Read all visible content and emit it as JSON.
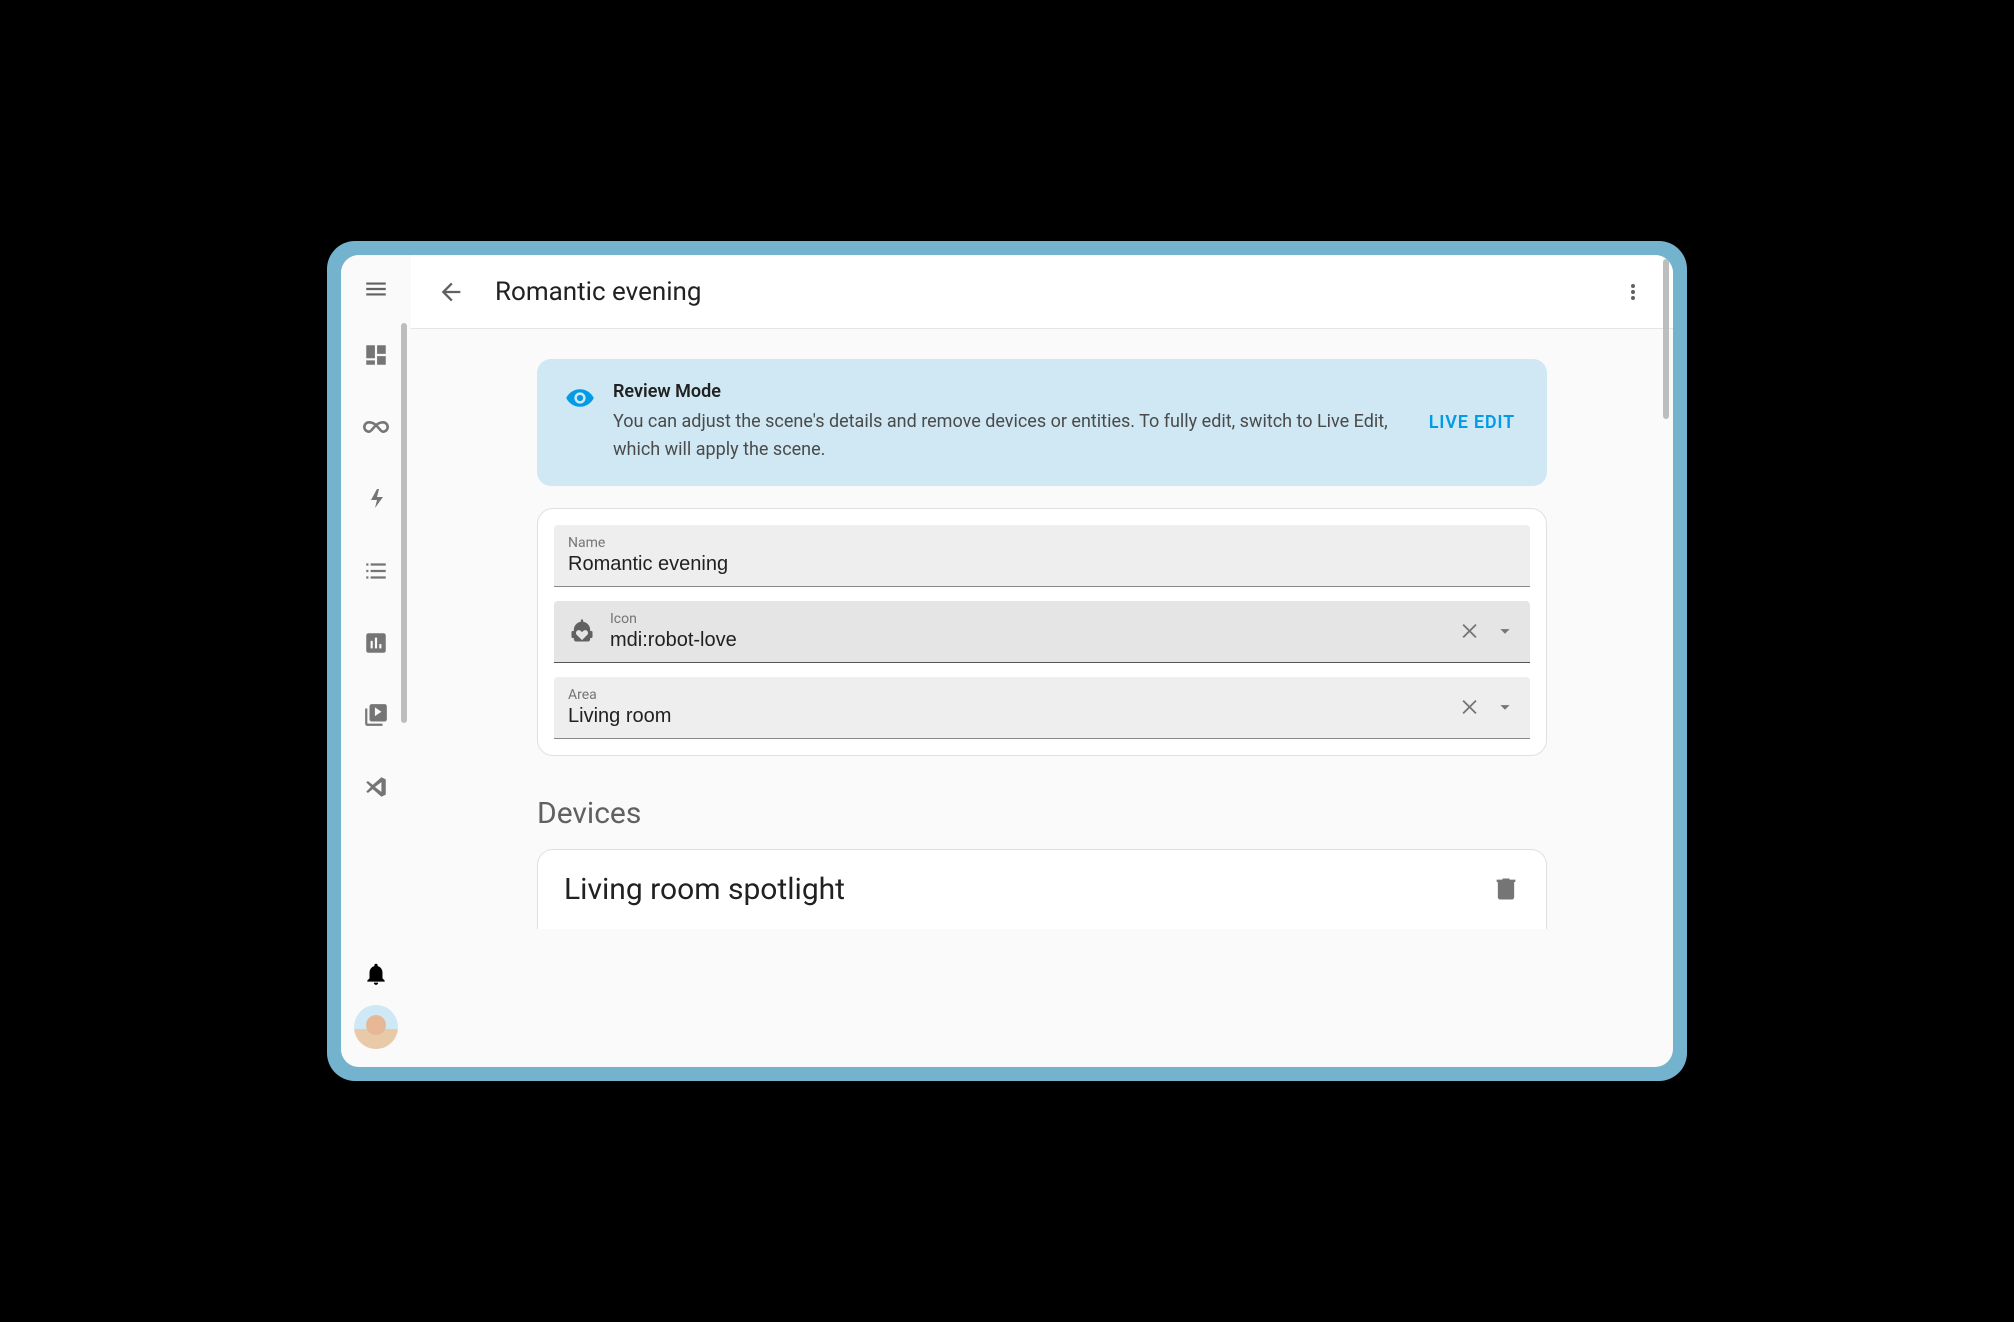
{
  "header": {
    "title": "Romantic evening"
  },
  "review_banner": {
    "title": "Review Mode",
    "body": "You can adjust the scene's details and remove devices or entities. To fully edit, switch to Live Edit, which will apply the scene.",
    "action": "LIVE EDIT"
  },
  "fields": {
    "name_label": "Name",
    "name_value": "Romantic evening",
    "icon_label": "Icon",
    "icon_value": "mdi:robot-love",
    "area_label": "Area",
    "area_value": "Living room"
  },
  "devices": {
    "section_title": "Devices",
    "items": [
      {
        "name": "Living room spotlight"
      }
    ]
  }
}
